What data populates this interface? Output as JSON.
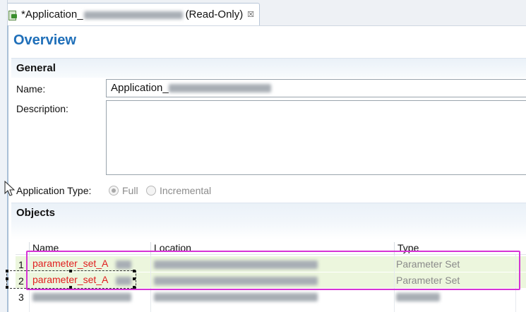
{
  "tab": {
    "title": "*Application_",
    "suffix": "(Read-Only)",
    "close_glyph": "☒"
  },
  "overview": {
    "title": "Overview"
  },
  "general": {
    "title": "General",
    "name_label": "Name:",
    "name_value": "Application_",
    "description_label": "Description:",
    "description_value": "",
    "app_type_label": "Application Type:",
    "options": [
      {
        "label": "Full",
        "selected": true
      },
      {
        "label": "Incremental",
        "selected": false
      }
    ]
  },
  "objects": {
    "title": "Objects",
    "columns": [
      "Name",
      "Location",
      "Type"
    ],
    "rows": [
      {
        "num": "1",
        "name": "parameter_set_A",
        "type": "Parameter Set"
      },
      {
        "num": "2",
        "name": "parameter_set_A",
        "type": "Parameter Set"
      },
      {
        "num": "3",
        "name": "",
        "type": ""
      }
    ]
  },
  "colors": {
    "accent": "#1f6fb9",
    "highlight": "#d633d6",
    "selected_row": "#ecf6dd",
    "param_text": "#e02020"
  }
}
